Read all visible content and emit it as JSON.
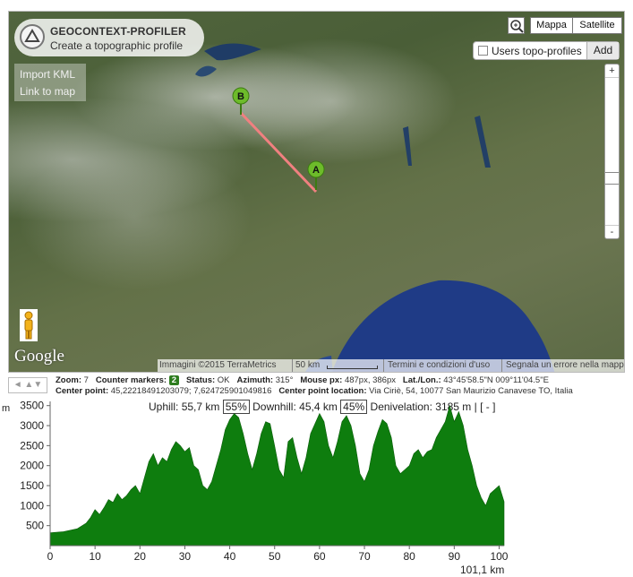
{
  "app": {
    "title": "GEOCONTEXT-PROFILER",
    "subtitle": "Create a topographic profile"
  },
  "map_controls": {
    "import_kml": "Import KML",
    "link_to_map": "Link to map",
    "map_types": [
      "Mappa",
      "Satellite"
    ],
    "users_toggle_label": "Users topo-profiles",
    "add_label": "Add",
    "zoom_in": "+",
    "zoom_out": "-",
    "google_logo": "Google",
    "attribution": {
      "imagery": "Immagini ©2015 TerraMetrics",
      "scale": "50 km",
      "terms": "Termini e condizioni d'uso",
      "report": "Segnala un errore nella mappa"
    }
  },
  "markers": [
    {
      "label": "A",
      "color": "#6dbb2a"
    },
    {
      "label": "B",
      "color": "#6dbb2a"
    }
  ],
  "info": {
    "nav": "◄ ▲▼",
    "zoom": {
      "label": "Zoom:",
      "value": "7"
    },
    "counter_markers": {
      "label": "Counter markers:",
      "value": "2"
    },
    "status": {
      "label": "Status:",
      "value": "OK"
    },
    "azimuth": {
      "label": "Azimuth:",
      "value": "315°"
    },
    "mouse_px": {
      "label": "Mouse px:",
      "value": "487px, 386px"
    },
    "lat_lon": {
      "label": "Lat./Lon.:",
      "value": "43°45'58.5\"N 009°11'04.5\"E"
    },
    "center_point": {
      "label": "Center point:",
      "value": "45,22218491203079; 7,624725901049816"
    },
    "center_location": {
      "label": "Center point location:",
      "value": "Via Ciriè, 54, 10077 San Maurizio Canavese TO, Italia"
    }
  },
  "profile_stats": {
    "uphill_label": "Uphill:",
    "uphill_value": "55,7 km",
    "uphill_pct": "55%",
    "downhill_label": "Downhill:",
    "downhill_value": "45,4 km",
    "downhill_pct": "45%",
    "denivelation_label": "Denivelation:",
    "denivelation_value": "3185 m",
    "controls": "| [ - ]"
  },
  "colors": {
    "fill": "#0e7d0e",
    "route": "#f08080",
    "badge": "#2e7d1f"
  },
  "chart_data": {
    "type": "area",
    "ylabel": "m",
    "xlabel": "km",
    "total_distance": "101,1 km",
    "xlim": [
      0,
      101.1
    ],
    "ylim": [
      0,
      3650
    ],
    "x_ticks": [
      0,
      10,
      20,
      30,
      40,
      50,
      60,
      70,
      80,
      90,
      100
    ],
    "y_ticks": [
      500,
      1000,
      1500,
      2000,
      2500,
      3000,
      3500
    ],
    "x": [
      0,
      3,
      6,
      8,
      9,
      10,
      11,
      12,
      13,
      14,
      15,
      16,
      17,
      18,
      19,
      20,
      21,
      22,
      23,
      24,
      25,
      26,
      27,
      28,
      29,
      30,
      31,
      32,
      33,
      34,
      35,
      36,
      37,
      38,
      39,
      40,
      41,
      42,
      43,
      44,
      45,
      46,
      47,
      48,
      49,
      50,
      51,
      52,
      53,
      54,
      55,
      56,
      57,
      58,
      59,
      60,
      61,
      62,
      63,
      64,
      65,
      66,
      67,
      68,
      69,
      70,
      71,
      72,
      73,
      74,
      75,
      76,
      77,
      78,
      79,
      80,
      81,
      82,
      83,
      84,
      85,
      86,
      87,
      88,
      89,
      90,
      91,
      92,
      93,
      94,
      95,
      96,
      97,
      98,
      99,
      100,
      101.1
    ],
    "y": [
      320,
      350,
      420,
      560,
      700,
      900,
      780,
      950,
      1150,
      1080,
      1300,
      1150,
      1250,
      1400,
      1500,
      1300,
      1700,
      2100,
      2300,
      2000,
      2200,
      2100,
      2400,
      2600,
      2500,
      2350,
      2450,
      2000,
      1900,
      1500,
      1400,
      1600,
      2000,
      2400,
      2900,
      3150,
      3300,
      3200,
      2800,
      2300,
      1900,
      2300,
      2800,
      3100,
      3050,
      2500,
      1900,
      1700,
      2600,
      2700,
      2200,
      1800,
      2200,
      2800,
      3050,
      3300,
      3100,
      2500,
      2200,
      2600,
      3100,
      3250,
      3000,
      2500,
      1800,
      1600,
      1900,
      2500,
      2850,
      3150,
      3050,
      2700,
      2000,
      1800,
      1900,
      2000,
      2300,
      2400,
      2200,
      2350,
      2400,
      2700,
      2900,
      3100,
      3500,
      3100,
      3350,
      3000,
      2400,
      2000,
      1500,
      1200,
      1000,
      1300,
      1400,
      1500,
      1100
    ]
  }
}
